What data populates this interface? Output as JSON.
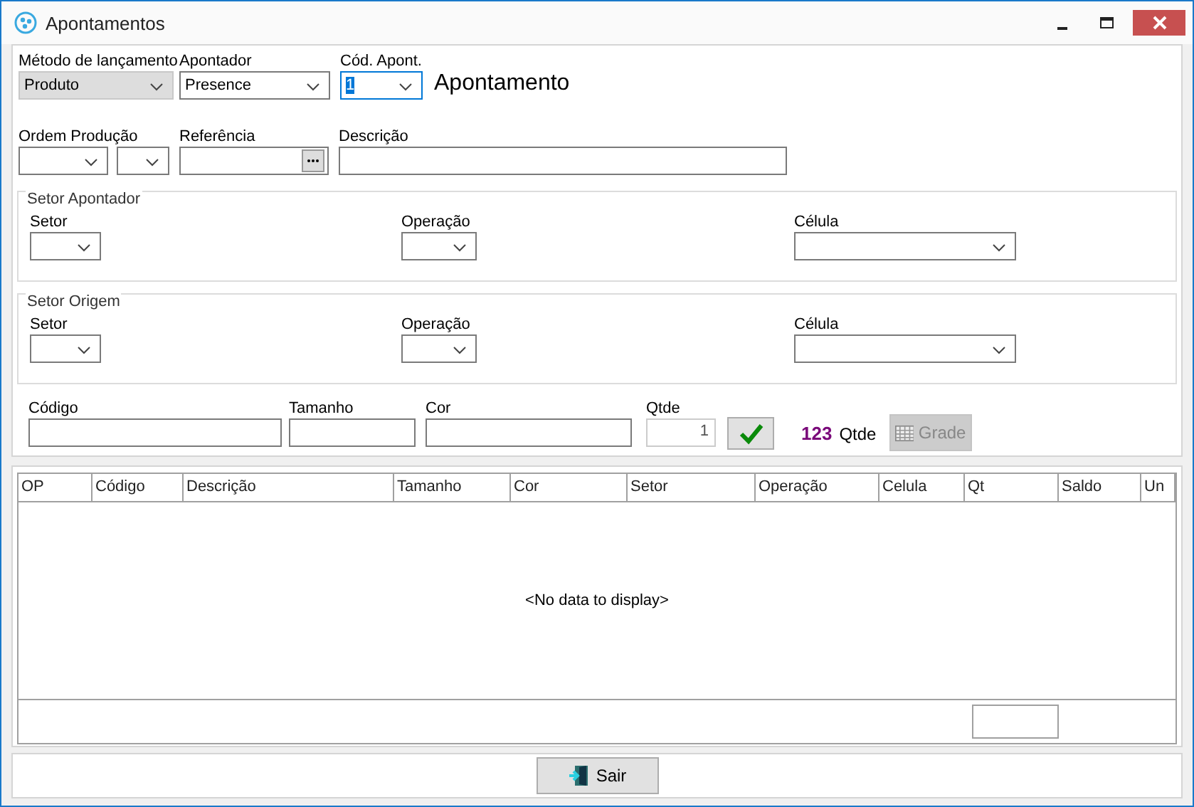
{
  "window": {
    "title": "Apontamentos"
  },
  "top_fields": [
    {
      "label": "Método de lançamento",
      "value": "Produto",
      "disabled": true,
      "focused": false
    },
    {
      "label": "Apontador",
      "value": "Presence",
      "disabled": false,
      "focused": false
    },
    {
      "label": "Cód. Apont.",
      "value": "1",
      "disabled": false,
      "focused": true
    }
  ],
  "heading": "Apontamento",
  "order_fields": [
    {
      "label": "Ordem Produção"
    },
    {
      "label": "Referência"
    },
    {
      "label": "Descrição"
    }
  ],
  "groups": [
    {
      "title": "Setor Apontador",
      "fields": [
        "Setor",
        "Operação",
        "Célula"
      ]
    },
    {
      "title": "Setor Origem",
      "fields": [
        "Setor",
        "Operação",
        "Célula"
      ]
    }
  ],
  "item_fields": [
    {
      "label": "Código"
    },
    {
      "label": "Tamanho"
    },
    {
      "label": "Cor"
    },
    {
      "label": "Qtde",
      "value": "1"
    }
  ],
  "counter": {
    "value": "123",
    "label": "Qtde"
  },
  "grade_button": {
    "label": "Grade",
    "disabled": true
  },
  "table": {
    "columns": [
      "OP",
      "Código",
      "Descrição",
      "Tamanho",
      "Cor",
      "Setor",
      "Operação",
      "Celula",
      "Qt",
      "Saldo",
      "Un"
    ],
    "empty_text": "<No data to display>"
  },
  "exit_button": {
    "label": "Sair"
  }
}
